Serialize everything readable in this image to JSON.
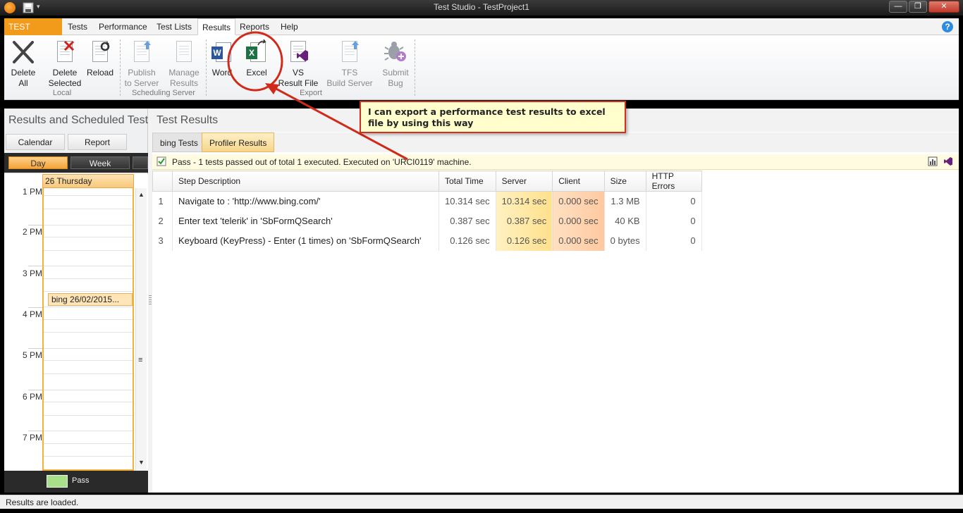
{
  "window": {
    "title": "Test Studio - TestProject1",
    "minimize": "—",
    "maximize": "❐",
    "close": "✕"
  },
  "ribbon": {
    "tabs": [
      "TEST STUDIO",
      "Tests",
      "Performance",
      "Test Lists",
      "Results",
      "Reports",
      "Help"
    ],
    "active_tab": "Results",
    "help": "?",
    "buttons": {
      "delete_all": [
        "Delete",
        "All"
      ],
      "delete_selected": [
        "Delete",
        "Selected"
      ],
      "reload": "Reload",
      "publish": [
        "Publish",
        "to Server"
      ],
      "manage": [
        "Manage",
        "Results"
      ],
      "word": "Word",
      "excel": "Excel",
      "vs": [
        "VS",
        "Result File"
      ],
      "tfs": [
        "TFS",
        "Build Server"
      ],
      "submit": [
        "Submit",
        "Bug"
      ]
    },
    "groups": {
      "local": "Local",
      "scheduling": "Scheduling Server",
      "export": "Export"
    }
  },
  "left_panel": {
    "title": "Results and Scheduled Test Li",
    "calendar_btn": "Calendar",
    "report_btn": "Report",
    "day_btn": "Day",
    "week_btn": "Week",
    "day_header": "26 Thursday",
    "times": [
      "1 PM",
      "2 PM",
      "3 PM",
      "4 PM",
      "5 PM",
      "6 PM",
      "7 PM"
    ],
    "appointment": "bing 26/02/2015...",
    "legend_pass": "Pass"
  },
  "right_panel": {
    "title": "Test Results",
    "breadcrumb": [
      "bing Tests",
      "Profiler Results"
    ],
    "status": "Pass - 1 tests passed out of total 1 executed. Executed on 'URCI0119' machine.",
    "columns": [
      "",
      "Step Description",
      "Total Time",
      "Server",
      "Client",
      "Size",
      "HTTP Errors"
    ],
    "rows": [
      {
        "idx": "1",
        "desc": "Navigate to : 'http://www.bing.com/'",
        "total": "10.314 sec",
        "server": "10.314 sec",
        "client": "0.000 sec",
        "size": "1.3 MB",
        "errors": "0"
      },
      {
        "idx": "2",
        "desc": "Enter text 'telerik' in 'SbFormQSearch'",
        "total": "0.387 sec",
        "server": "0.387 sec",
        "client": "0.000 sec",
        "size": "40 KB",
        "errors": "0"
      },
      {
        "idx": "3",
        "desc": "Keyboard (KeyPress) - Enter (1 times) on 'SbFormQSearch'",
        "total": "0.126 sec",
        "server": "0.126 sec",
        "client": "0.000 sec",
        "size": "0 bytes",
        "errors": "0"
      }
    ]
  },
  "statusbar": "Results are loaded.",
  "annotation": "I can export a performance test results to excel file by using this way",
  "colors": {
    "accent": "#f29a1a",
    "annotation_red": "#d02a1a",
    "pass_green": "#a8e08a"
  }
}
